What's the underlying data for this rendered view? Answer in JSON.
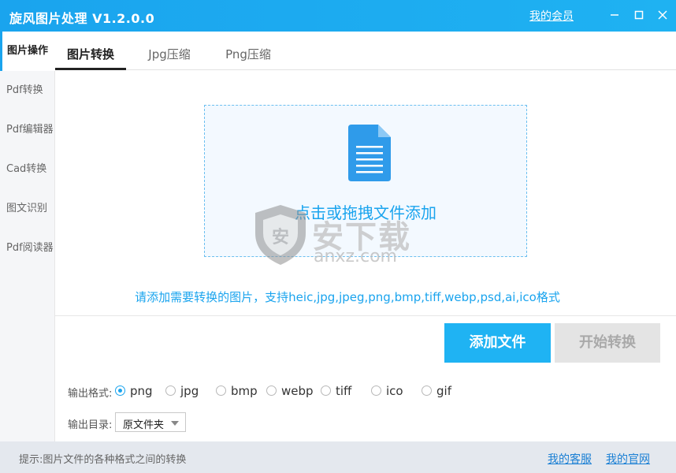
{
  "app": {
    "title": "旋风图片处理 V1.2.0.0",
    "member_link": "我的会员"
  },
  "window_controls": [
    "minimize-icon",
    "maximize-icon",
    "close-icon"
  ],
  "sidebar": {
    "items": [
      {
        "label": "图片操作",
        "active": true
      },
      {
        "label": "Pdf转换",
        "active": false
      },
      {
        "label": "Pdf编辑器",
        "active": false
      },
      {
        "label": "Cad转换",
        "active": false
      },
      {
        "label": "图文识别",
        "active": false
      },
      {
        "label": "Pdf阅读器",
        "active": false
      }
    ]
  },
  "tabs": [
    {
      "label": "图片转换",
      "active": true
    },
    {
      "label": "Jpg压缩",
      "active": false
    },
    {
      "label": "Png压缩",
      "active": false
    }
  ],
  "dropzone": {
    "icon": "document-icon",
    "label": "点击或拖拽文件添加"
  },
  "watermark": {
    "text": "安下载",
    "domain": "anxz.com"
  },
  "hint": "请添加需要转换的图片，支持heic,jpg,jpeg,png,bmp,tiff,webp,psd,ai,ico格式",
  "actions": {
    "add_files": "添加文件",
    "start_convert": "开始转换"
  },
  "output_format": {
    "label": "输出格式:",
    "options": [
      "png",
      "jpg",
      "bmp",
      "webp",
      "tiff",
      "ico",
      "gif"
    ],
    "selected": "png"
  },
  "output_dir": {
    "label": "输出目录:",
    "value": "原文件夹"
  },
  "statusbar": {
    "tip": "提示:图片文件的各种格式之间的转换",
    "service_link": "我的客服",
    "website_link": "我的官网"
  },
  "colors": {
    "accent": "#1aa4ee",
    "add_button": "#1fb3f3",
    "disabled_button": "#e4e4e4",
    "statusbar": "#e4e8ee"
  }
}
